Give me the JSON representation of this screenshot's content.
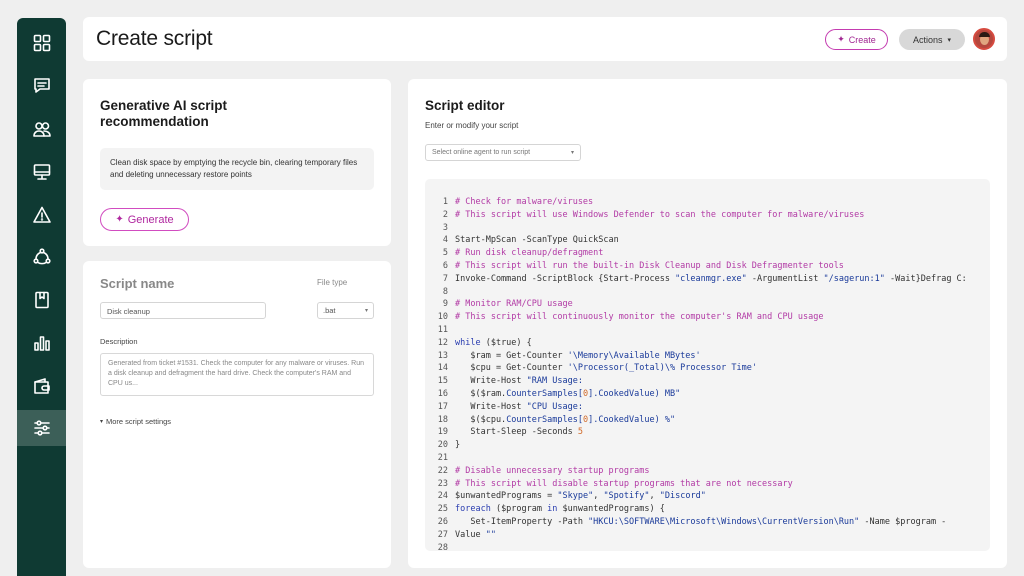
{
  "sidebar": {
    "items": [
      {
        "icon": "dashboard-icon",
        "active": false
      },
      {
        "icon": "chat-icon",
        "active": false
      },
      {
        "icon": "users-icon",
        "active": false
      },
      {
        "icon": "monitor-icon",
        "active": false
      },
      {
        "icon": "warning-icon",
        "active": false
      },
      {
        "icon": "network-icon",
        "active": false
      },
      {
        "icon": "book-icon",
        "active": false
      },
      {
        "icon": "chart-icon",
        "active": false
      },
      {
        "icon": "wallet-icon",
        "active": false
      },
      {
        "icon": "sliders-icon",
        "active": true
      }
    ]
  },
  "header": {
    "title": "Create script",
    "create_label": "Create",
    "actions_label": "Actions"
  },
  "generative": {
    "title": "Generative AI script recommendation",
    "prompt": "Clean disk space by emptying the recycle bin, clearing temporary files and deleting unnecessary restore points",
    "generate_label": "Generate"
  },
  "script_form": {
    "name_label": "Script name",
    "file_type_label": "File type",
    "name_value": "Disk cleanup",
    "file_type_value": ".bat",
    "description_label": "Description",
    "description_value": "Generated from ticket #1531. Check the computer for any malware or viruses. Run a disk cleanup and defragment the hard drive. Check the computer's RAM and CPU us...",
    "more_settings_label": "More script settings"
  },
  "editor": {
    "title": "Script editor",
    "subtitle": "Enter or modify your script",
    "agent_placeholder": "Select online agent to run script",
    "lines": [
      [
        [
          "# Check for malware/viruses",
          "comment"
        ]
      ],
      [
        [
          "# This script will use Windows Defender to scan the computer for malware/viruses",
          "comment"
        ]
      ],
      [],
      [
        [
          "Start-MpScan -ScanType QuickScan",
          "plain"
        ]
      ],
      [
        [
          "# Run disk cleanup/defragment",
          "comment"
        ]
      ],
      [
        [
          "# This script will run the built-in Disk Cleanup and Disk Defragmenter tools",
          "comment"
        ]
      ],
      [
        [
          "Invoke-Command -ScriptBlock {Start-Process ",
          "plain"
        ],
        [
          "\"cleanmgr.exe\"",
          "string"
        ],
        [
          " -ArgumentList ",
          "plain"
        ],
        [
          "\"/sagerun:1\"",
          "string"
        ],
        [
          " -Wait}Defrag C:",
          "plain"
        ]
      ],
      [],
      [
        [
          "# Monitor RAM/CPU usage",
          "comment"
        ]
      ],
      [
        [
          "# This script will continuously monitor the computer's RAM and CPU usage",
          "comment"
        ]
      ],
      [],
      [
        [
          "while",
          "keyword"
        ],
        [
          " ($true) {",
          "plain"
        ]
      ],
      [
        [
          "   $ram = Get-Counter ",
          "plain"
        ],
        [
          "'\\Memory\\Available MBytes'",
          "string"
        ]
      ],
      [
        [
          "   $cpu = Get-Counter ",
          "plain"
        ],
        [
          "'\\Processor(_Total)\\% Processor Time'",
          "string"
        ]
      ],
      [
        [
          "   Write-Host ",
          "plain"
        ],
        [
          "\"RAM Usage:",
          "string"
        ]
      ],
      [
        [
          "   $($ram.",
          "plain"
        ],
        [
          "CounterSamples[",
          "string"
        ],
        [
          "0",
          "num"
        ],
        [
          "].CookedValue) MB\"",
          "string"
        ]
      ],
      [
        [
          "   Write-Host ",
          "plain"
        ],
        [
          "\"CPU Usage:",
          "string"
        ]
      ],
      [
        [
          "   $($cpu.",
          "plain"
        ],
        [
          "CounterSamples[",
          "string"
        ],
        [
          "0",
          "num"
        ],
        [
          "].CookedValue) %\"",
          "string"
        ]
      ],
      [
        [
          "   Start-Sleep ",
          "plain"
        ],
        [
          "-Seconds ",
          "plain"
        ],
        [
          "5",
          "num"
        ]
      ],
      [
        [
          "}",
          "plain"
        ]
      ],
      [],
      [
        [
          "# Disable unnecessary startup programs",
          "comment"
        ]
      ],
      [
        [
          "# This script will disable startup programs that are not necessary",
          "comment"
        ]
      ],
      [
        [
          "$unwantedPrograms = ",
          "plain"
        ],
        [
          "\"Skype\"",
          "string"
        ],
        [
          ", ",
          "plain"
        ],
        [
          "\"Spotify\"",
          "string"
        ],
        [
          ", ",
          "plain"
        ],
        [
          "\"Discord\"",
          "string"
        ]
      ],
      [
        [
          "foreach",
          "keyword"
        ],
        [
          " ($program ",
          "plain"
        ],
        [
          "in",
          "keyword"
        ],
        [
          " $unwantedPrograms) {",
          "plain"
        ]
      ],
      [
        [
          "   Set-ItemProperty -Path ",
          "plain"
        ],
        [
          "\"HKCU:\\SOFTWARE\\Microsoft\\Windows\\CurrentVersion\\Run\"",
          "string"
        ],
        [
          " -Name $program -",
          "plain"
        ]
      ],
      [
        [
          "Value ",
          "plain"
        ],
        [
          "\"\"",
          "string"
        ]
      ],
      []
    ]
  },
  "colors": {
    "sidebar_bg": "#0f3a33",
    "accent": "#c43bb0",
    "comment": "#b23aa5",
    "keyword": "#2a3db0"
  }
}
